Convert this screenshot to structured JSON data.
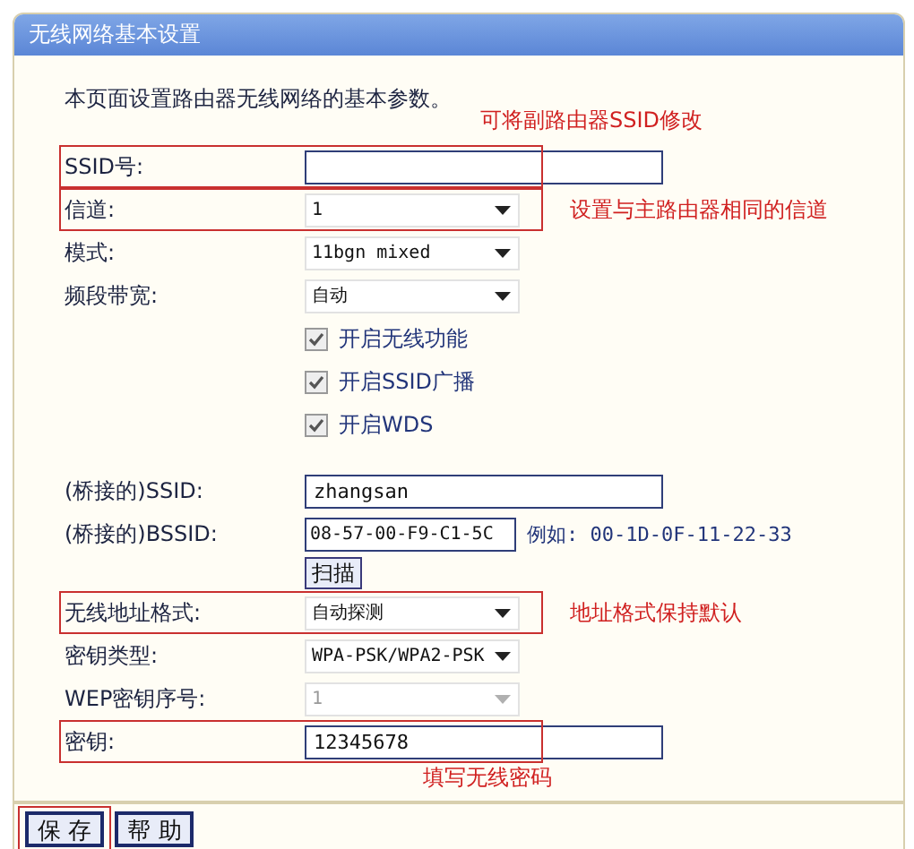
{
  "panel": {
    "title": "无线网络基本设置",
    "description": "本页面设置路由器无线网络的基本参数。",
    "groups": [
      {
        "fields": [
          {
            "kind": "text",
            "label": "SSID号:",
            "highlighted": true,
            "note": {
              "text": "可将副路由器SSID修改",
              "kind": "above"
            }
          },
          {
            "kind": "select",
            "label": "信道:",
            "value": "1",
            "disabled": false,
            "highlighted": true,
            "note": {
              "text": "设置与主路由器相同的信道",
              "kind": "right"
            }
          },
          {
            "kind": "select",
            "label": "模式:",
            "value": "11bgn mixed",
            "disabled": false,
            "highlighted": false
          },
          {
            "kind": "select",
            "label": "频段带宽:",
            "value": "自动",
            "disabled": false,
            "highlighted": false
          },
          {
            "kind": "checkbox",
            "text": "开启无线功能",
            "checked": true
          },
          {
            "kind": "checkbox",
            "text": "开启SSID广播",
            "checked": true
          },
          {
            "kind": "checkbox",
            "text": "开启WDS",
            "checked": true
          }
        ]
      },
      {
        "fields": [
          {
            "kind": "text",
            "label": "(桥接的)SSID:",
            "value": "zhangsan",
            "highlighted": false
          },
          {
            "kind": "short_text",
            "label": "(桥接的)BSSID:",
            "value": "08-57-00-F9-C1-5C",
            "hint": "例如: 00-1D-0F-11-22-33",
            "highlighted": false
          },
          {
            "kind": "button",
            "text": "扫描"
          },
          {
            "kind": "select",
            "label": "无线地址格式:",
            "value": "自动探测",
            "disabled": false,
            "highlighted": true,
            "note": {
              "text": "地址格式保持默认",
              "kind": "right"
            }
          },
          {
            "kind": "select",
            "label": "密钥类型:",
            "value": "WPA-PSK/WPA2-PSK",
            "disabled": false,
            "highlighted": false
          },
          {
            "kind": "select",
            "label": "WEP密钥序号:",
            "value": "1",
            "disabled": true,
            "highlighted": false
          },
          {
            "kind": "text",
            "label": "密钥:",
            "value": "12345678",
            "highlighted": true,
            "note": {
              "text": "填写无线密码",
              "kind": "below"
            }
          }
        ]
      }
    ],
    "buttons": [
      {
        "label": "保 存",
        "highlighted": true
      },
      {
        "label": "帮 助",
        "highlighted": false
      }
    ]
  }
}
